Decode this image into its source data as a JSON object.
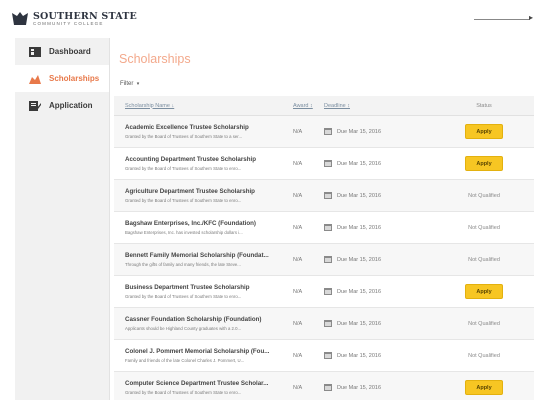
{
  "header": {
    "logo_name": "SOUTHERN STATE",
    "logo_sub": "COMMUNITY COLLEGE"
  },
  "sidebar": {
    "items": [
      {
        "label": "Dashboard",
        "icon": "dashboard-icon",
        "active": false
      },
      {
        "label": "Scholarships",
        "icon": "scholarship-icon",
        "active": true
      },
      {
        "label": "Application",
        "icon": "application-icon",
        "active": false
      }
    ]
  },
  "main": {
    "title": "Scholarships",
    "filter_label": "Filter",
    "columns": {
      "name": "Scholarship Name ↓",
      "award": "Award ↕",
      "deadline": "Deadline ↕",
      "status": "Status"
    },
    "rows": [
      {
        "title": "Academic Excellence Trustee Scholarship",
        "desc": "Granted by the Board of Trustees of Southern State to a ser...",
        "award": "N/A",
        "deadline": "Due Mar 15, 2016",
        "status": "Apply"
      },
      {
        "title": "Accounting Department Trustee Scholarship",
        "desc": "Granted by the Board of Trustees of Southern State to enro...",
        "award": "N/A",
        "deadline": "Due Mar 15, 2016",
        "status": "Apply"
      },
      {
        "title": "Agriculture Department Trustee Scholarship",
        "desc": "Granted by the Board of Trustees of Southern State to enro...",
        "award": "N/A",
        "deadline": "Due Mar 15, 2016",
        "status": "Not Qualified"
      },
      {
        "title": "Bagshaw Enterprises, Inc./KFC (Foundation)",
        "desc": "Bagshaw Enterprises, Inc. has invested scholarship dollars i...",
        "award": "N/A",
        "deadline": "Due Mar 15, 2016",
        "status": "Not Qualified"
      },
      {
        "title": "Bennett Family Memorial Scholarship (Foundat...",
        "desc": "Through the gifts of family and many friends, the late Steve...",
        "award": "N/A",
        "deadline": "Due Mar 15, 2016",
        "status": "Not Qualified"
      },
      {
        "title": "Business Department Trustee Scholarship",
        "desc": "Granted by the Board of Trustees of Southern State to enro...",
        "award": "N/A",
        "deadline": "Due Mar 15, 2016",
        "status": "Apply"
      },
      {
        "title": "Cassner Foundation Scholarship (Foundation)",
        "desc": "Applicants should be Highland County graduates with a 2.0...",
        "award": "N/A",
        "deadline": "Due Mar 15, 2016",
        "status": "Not Qualified"
      },
      {
        "title": "Colonel J. Pommert Memorial Scholarship (Fou...",
        "desc": "Family and friends of the late Colonel Charles J. Pommert, U...",
        "award": "N/A",
        "deadline": "Due Mar 15, 2016",
        "status": "Not Qualified"
      },
      {
        "title": "Computer Science Department Trustee Scholar...",
        "desc": "Granted by the Board of Trustees of Southern State to enro...",
        "award": "N/A",
        "deadline": "Due Mar 15, 2016",
        "status": "Apply"
      }
    ]
  },
  "colors": {
    "accent": "#e8794a",
    "title": "#f3a98c",
    "apply": "#f7c623"
  }
}
